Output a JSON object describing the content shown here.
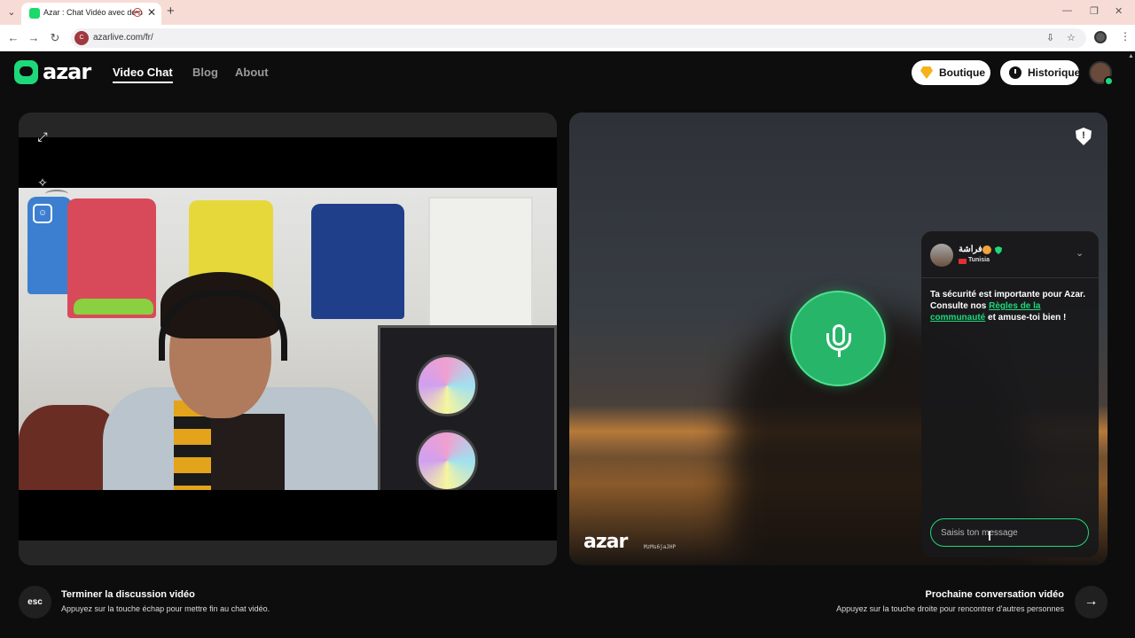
{
  "browser": {
    "tab_title": "Azar : Chat Vidéo avec de n",
    "url": "azarlive.com/fr/",
    "site_badge": "C",
    "icons": [
      "chevron-down-icon",
      "close-icon",
      "plus-icon",
      "back-icon",
      "forward-icon",
      "reload-icon",
      "install-icon",
      "star-icon",
      "extension-icon",
      "kebab-icon"
    ]
  },
  "header": {
    "logo": "azar",
    "nav": [
      {
        "label": "Video Chat",
        "active": true
      },
      {
        "label": "Blog",
        "active": false
      },
      {
        "label": "About",
        "active": false
      }
    ],
    "boutique_label": "Boutique",
    "historique_label": "Historique"
  },
  "right_video": {
    "watermark": "azar",
    "watermark_id": "MzMs6jaJHP"
  },
  "chat": {
    "name": "فراشة",
    "country": "Tunisia",
    "message_prefix": "Ta sécurité est importante pour Azar. Consulte nos ",
    "message_link": "Règles de la communauté",
    "message_suffix": " et amuse-toi bien !",
    "input_placeholder": "Saisis ton message"
  },
  "footer": {
    "left_key": "esc",
    "left_title": "Terminer la discussion vidéo",
    "left_sub": "Appuyez sur la touche échap pour mettre fin au chat vidéo.",
    "right_title": "Prochaine conversation vidéo",
    "right_sub": "Appuyez sur la touche droite pour rencontrer d'autres personnes"
  },
  "colors": {
    "accent": "#1ed97a",
    "mic_button": "#27b56a",
    "background": "#0d0d0d"
  }
}
